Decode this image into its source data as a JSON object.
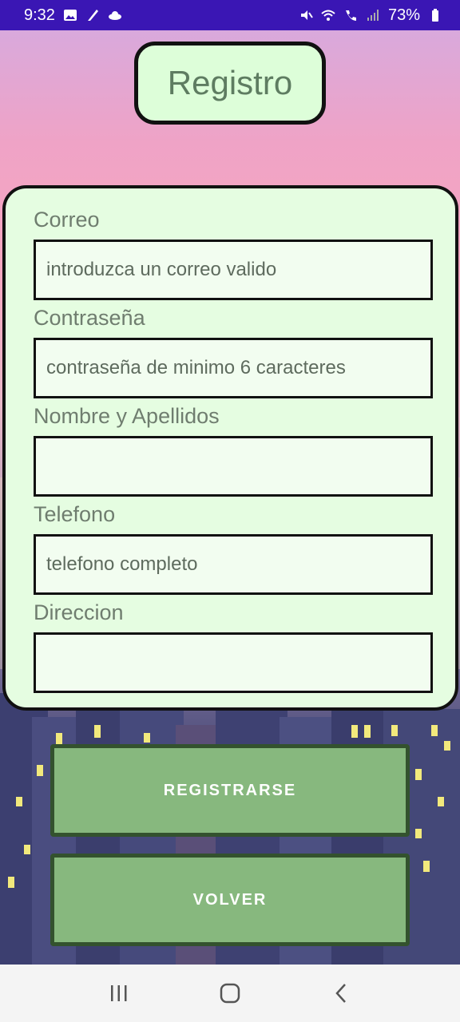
{
  "status_bar": {
    "time": "9:32",
    "battery": "73%",
    "left_icons": [
      "image-icon",
      "feather-icon",
      "cloud-icon"
    ],
    "right_icons": [
      "mute-icon",
      "wifi-icon",
      "call-icon",
      "signal-icon",
      "battery-icon"
    ]
  },
  "header": {
    "title": "Registro"
  },
  "form": {
    "fields": [
      {
        "label": "Correo",
        "value": "",
        "placeholder": "introduzca un correo valido"
      },
      {
        "label": "Contraseña",
        "value": "",
        "placeholder": "contraseña de minimo 6 caracteres"
      },
      {
        "label": "Nombre y Apellidos",
        "value": "",
        "placeholder": ""
      },
      {
        "label": "Telefono",
        "value": "",
        "placeholder": "telefono completo"
      },
      {
        "label": "Direccion",
        "value": "",
        "placeholder": ""
      }
    ]
  },
  "buttons": {
    "register_label": "REGISTRARSE",
    "back_label": "VOLVER"
  },
  "nav": {
    "icons": [
      "recents-icon",
      "home-icon",
      "back-icon"
    ]
  },
  "colors": {
    "status_bar": "#3a16b4",
    "card": "#e5fde1",
    "button": "#87b87e",
    "button_border": "#33522e",
    "title_text": "#5e7c61"
  }
}
